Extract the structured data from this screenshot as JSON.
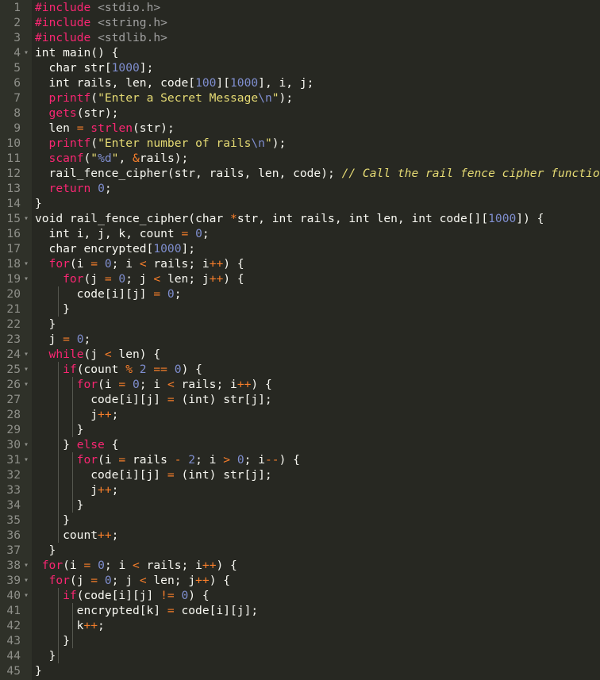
{
  "editor": {
    "lines": [
      {
        "num": "1",
        "fold": "",
        "indent": 0,
        "tokens": [
          {
            "t": "#include ",
            "c": "c-include"
          },
          {
            "t": "<stdio.h>",
            "c": "c-header"
          }
        ]
      },
      {
        "num": "2",
        "fold": "",
        "indent": 0,
        "tokens": [
          {
            "t": "#include ",
            "c": "c-include"
          },
          {
            "t": "<string.h>",
            "c": "c-header"
          }
        ]
      },
      {
        "num": "3",
        "fold": "",
        "indent": 0,
        "tokens": [
          {
            "t": "#include ",
            "c": "c-include"
          },
          {
            "t": "<stdlib.h>",
            "c": "c-header"
          }
        ]
      },
      {
        "num": "4",
        "fold": "▾",
        "indent": 0,
        "tokens": [
          {
            "t": "int main() {",
            "c": ""
          }
        ]
      },
      {
        "num": "5",
        "fold": "",
        "indent": 2,
        "tokens": [
          {
            "t": "char str[",
            "c": ""
          },
          {
            "t": "1000",
            "c": "c-num"
          },
          {
            "t": "];",
            "c": ""
          }
        ]
      },
      {
        "num": "6",
        "fold": "",
        "indent": 2,
        "tokens": [
          {
            "t": "int rails, len, code[",
            "c": ""
          },
          {
            "t": "100",
            "c": "c-num"
          },
          {
            "t": "][",
            "c": ""
          },
          {
            "t": "1000",
            "c": "c-num"
          },
          {
            "t": "], i, j;",
            "c": ""
          }
        ]
      },
      {
        "num": "7",
        "fold": "",
        "indent": 2,
        "tokens": [
          {
            "t": "printf",
            "c": "c-func"
          },
          {
            "t": "(",
            "c": ""
          },
          {
            "t": "\"Enter a Secret Message",
            "c": "c-str"
          },
          {
            "t": "\\n",
            "c": "c-esc"
          },
          {
            "t": "\"",
            "c": "c-str"
          },
          {
            "t": ");",
            "c": ""
          }
        ]
      },
      {
        "num": "8",
        "fold": "",
        "indent": 2,
        "tokens": [
          {
            "t": "gets",
            "c": "c-func"
          },
          {
            "t": "(str);",
            "c": ""
          }
        ]
      },
      {
        "num": "9",
        "fold": "",
        "indent": 2,
        "tokens": [
          {
            "t": "len ",
            "c": ""
          },
          {
            "t": "=",
            "c": "c-op"
          },
          {
            "t": " ",
            "c": ""
          },
          {
            "t": "strlen",
            "c": "c-func"
          },
          {
            "t": "(str);",
            "c": ""
          }
        ]
      },
      {
        "num": "10",
        "fold": "",
        "indent": 2,
        "tokens": [
          {
            "t": "printf",
            "c": "c-func"
          },
          {
            "t": "(",
            "c": ""
          },
          {
            "t": "\"Enter number of rails",
            "c": "c-str"
          },
          {
            "t": "\\n",
            "c": "c-esc"
          },
          {
            "t": "\"",
            "c": "c-str"
          },
          {
            "t": ");",
            "c": ""
          }
        ]
      },
      {
        "num": "11",
        "fold": "",
        "indent": 2,
        "tokens": [
          {
            "t": "scanf",
            "c": "c-func"
          },
          {
            "t": "(",
            "c": ""
          },
          {
            "t": "\"",
            "c": "c-str"
          },
          {
            "t": "%d",
            "c": "c-esc"
          },
          {
            "t": "\"",
            "c": "c-str"
          },
          {
            "t": ", ",
            "c": ""
          },
          {
            "t": "&",
            "c": "c-op"
          },
          {
            "t": "rails);",
            "c": ""
          }
        ]
      },
      {
        "num": "12",
        "fold": "",
        "indent": 2,
        "tokens": [
          {
            "t": "rail_fence_cipher(str, rails, len, code); ",
            "c": ""
          },
          {
            "t": "// Call the rail fence cipher function",
            "c": "c-cmt"
          }
        ]
      },
      {
        "num": "13",
        "fold": "",
        "indent": 2,
        "tokens": [
          {
            "t": "return ",
            "c": "c-kw"
          },
          {
            "t": "0",
            "c": "c-num"
          },
          {
            "t": ";",
            "c": ""
          }
        ]
      },
      {
        "num": "14",
        "fold": "",
        "indent": 0,
        "tokens": [
          {
            "t": "}",
            "c": ""
          }
        ]
      },
      {
        "num": "15",
        "fold": "▾",
        "indent": 0,
        "tokens": [
          {
            "t": "void rail_fence_cipher(char ",
            "c": ""
          },
          {
            "t": "*",
            "c": "c-ptr"
          },
          {
            "t": "str, int rails, int len, int code[][",
            "c": ""
          },
          {
            "t": "1000",
            "c": "c-num"
          },
          {
            "t": "]) {",
            "c": ""
          }
        ]
      },
      {
        "num": "16",
        "fold": "",
        "indent": 2,
        "tokens": [
          {
            "t": "int i, j, k, count ",
            "c": ""
          },
          {
            "t": "=",
            "c": "c-op"
          },
          {
            "t": " ",
            "c": ""
          },
          {
            "t": "0",
            "c": "c-num"
          },
          {
            "t": ";",
            "c": ""
          }
        ]
      },
      {
        "num": "17",
        "fold": "",
        "indent": 2,
        "tokens": [
          {
            "t": "char encrypted[",
            "c": ""
          },
          {
            "t": "1000",
            "c": "c-num"
          },
          {
            "t": "];",
            "c": ""
          }
        ]
      },
      {
        "num": "18",
        "fold": "▾",
        "indent": 2,
        "tokens": [
          {
            "t": "for",
            "c": "c-kw"
          },
          {
            "t": "(i ",
            "c": ""
          },
          {
            "t": "=",
            "c": "c-op"
          },
          {
            "t": " ",
            "c": ""
          },
          {
            "t": "0",
            "c": "c-num"
          },
          {
            "t": "; i ",
            "c": ""
          },
          {
            "t": "<",
            "c": "c-op"
          },
          {
            "t": " rails; i",
            "c": ""
          },
          {
            "t": "++",
            "c": "c-op"
          },
          {
            "t": ") {",
            "c": ""
          }
        ]
      },
      {
        "num": "19",
        "fold": "▾",
        "indent": 4,
        "tokens": [
          {
            "t": "for",
            "c": "c-kw"
          },
          {
            "t": "(j ",
            "c": ""
          },
          {
            "t": "=",
            "c": "c-op"
          },
          {
            "t": " ",
            "c": ""
          },
          {
            "t": "0",
            "c": "c-num"
          },
          {
            "t": "; j ",
            "c": ""
          },
          {
            "t": "<",
            "c": "c-op"
          },
          {
            "t": " len; j",
            "c": ""
          },
          {
            "t": "++",
            "c": "c-op"
          },
          {
            "t": ") {",
            "c": ""
          }
        ]
      },
      {
        "num": "20",
        "fold": "",
        "indent": 6,
        "tokens": [
          {
            "t": "code[i][j] ",
            "c": ""
          },
          {
            "t": "=",
            "c": "c-op"
          },
          {
            "t": " ",
            "c": ""
          },
          {
            "t": "0",
            "c": "c-num"
          },
          {
            "t": ";",
            "c": ""
          }
        ]
      },
      {
        "num": "21",
        "fold": "",
        "indent": 4,
        "tokens": [
          {
            "t": "}",
            "c": ""
          }
        ]
      },
      {
        "num": "22",
        "fold": "",
        "indent": 2,
        "tokens": [
          {
            "t": "}",
            "c": ""
          }
        ]
      },
      {
        "num": "23",
        "fold": "",
        "indent": 2,
        "tokens": [
          {
            "t": "j ",
            "c": ""
          },
          {
            "t": "=",
            "c": "c-op"
          },
          {
            "t": " ",
            "c": ""
          },
          {
            "t": "0",
            "c": "c-num"
          },
          {
            "t": ";",
            "c": ""
          }
        ]
      },
      {
        "num": "24",
        "fold": "▾",
        "indent": 2,
        "tokens": [
          {
            "t": "while",
            "c": "c-kw"
          },
          {
            "t": "(j ",
            "c": ""
          },
          {
            "t": "<",
            "c": "c-op"
          },
          {
            "t": " len) {",
            "c": ""
          }
        ]
      },
      {
        "num": "25",
        "fold": "▾",
        "indent": 4,
        "tokens": [
          {
            "t": "if",
            "c": "c-kw"
          },
          {
            "t": "(count ",
            "c": ""
          },
          {
            "t": "%",
            "c": "c-op"
          },
          {
            "t": " ",
            "c": ""
          },
          {
            "t": "2",
            "c": "c-num"
          },
          {
            "t": " ",
            "c": ""
          },
          {
            "t": "==",
            "c": "c-op"
          },
          {
            "t": " ",
            "c": ""
          },
          {
            "t": "0",
            "c": "c-num"
          },
          {
            "t": ") {",
            "c": ""
          }
        ]
      },
      {
        "num": "26",
        "fold": "▾",
        "indent": 6,
        "tokens": [
          {
            "t": "for",
            "c": "c-kw"
          },
          {
            "t": "(i ",
            "c": ""
          },
          {
            "t": "=",
            "c": "c-op"
          },
          {
            "t": " ",
            "c": ""
          },
          {
            "t": "0",
            "c": "c-num"
          },
          {
            "t": "; i ",
            "c": ""
          },
          {
            "t": "<",
            "c": "c-op"
          },
          {
            "t": " rails; i",
            "c": ""
          },
          {
            "t": "++",
            "c": "c-op"
          },
          {
            "t": ") {",
            "c": ""
          }
        ]
      },
      {
        "num": "27",
        "fold": "",
        "indent": 8,
        "tokens": [
          {
            "t": "code[i][j] ",
            "c": ""
          },
          {
            "t": "=",
            "c": "c-op"
          },
          {
            "t": " (int) str[j];",
            "c": ""
          }
        ]
      },
      {
        "num": "28",
        "fold": "",
        "indent": 8,
        "tokens": [
          {
            "t": "j",
            "c": ""
          },
          {
            "t": "++",
            "c": "c-op"
          },
          {
            "t": ";",
            "c": ""
          }
        ]
      },
      {
        "num": "29",
        "fold": "",
        "indent": 6,
        "tokens": [
          {
            "t": "}",
            "c": ""
          }
        ]
      },
      {
        "num": "30",
        "fold": "▾",
        "indent": 4,
        "tokens": [
          {
            "t": "} ",
            "c": ""
          },
          {
            "t": "else",
            "c": "c-kw"
          },
          {
            "t": " {",
            "c": ""
          }
        ]
      },
      {
        "num": "31",
        "fold": "▾",
        "indent": 6,
        "tokens": [
          {
            "t": "for",
            "c": "c-kw"
          },
          {
            "t": "(i ",
            "c": ""
          },
          {
            "t": "=",
            "c": "c-op"
          },
          {
            "t": " rails ",
            "c": ""
          },
          {
            "t": "-",
            "c": "c-op"
          },
          {
            "t": " ",
            "c": ""
          },
          {
            "t": "2",
            "c": "c-num"
          },
          {
            "t": "; i ",
            "c": ""
          },
          {
            "t": ">",
            "c": "c-op"
          },
          {
            "t": " ",
            "c": ""
          },
          {
            "t": "0",
            "c": "c-num"
          },
          {
            "t": "; i",
            "c": ""
          },
          {
            "t": "--",
            "c": "c-op"
          },
          {
            "t": ") {",
            "c": ""
          }
        ]
      },
      {
        "num": "32",
        "fold": "",
        "indent": 8,
        "tokens": [
          {
            "t": "code[i][j] ",
            "c": ""
          },
          {
            "t": "=",
            "c": "c-op"
          },
          {
            "t": " (int) str[j];",
            "c": ""
          }
        ]
      },
      {
        "num": "33",
        "fold": "",
        "indent": 8,
        "tokens": [
          {
            "t": "j",
            "c": ""
          },
          {
            "t": "++",
            "c": "c-op"
          },
          {
            "t": ";",
            "c": ""
          }
        ]
      },
      {
        "num": "34",
        "fold": "",
        "indent": 6,
        "tokens": [
          {
            "t": "}",
            "c": ""
          }
        ]
      },
      {
        "num": "35",
        "fold": "",
        "indent": 4,
        "tokens": [
          {
            "t": "}",
            "c": ""
          }
        ]
      },
      {
        "num": "36",
        "fold": "",
        "indent": 4,
        "tokens": [
          {
            "t": "count",
            "c": ""
          },
          {
            "t": "++",
            "c": "c-op"
          },
          {
            "t": ";",
            "c": ""
          }
        ]
      },
      {
        "num": "37",
        "fold": "",
        "indent": 2,
        "tokens": [
          {
            "t": "}",
            "c": ""
          }
        ]
      },
      {
        "num": "38",
        "fold": "▾",
        "indent": 1,
        "tokens": [
          {
            "t": "for",
            "c": "c-kw"
          },
          {
            "t": "(i ",
            "c": ""
          },
          {
            "t": "=",
            "c": "c-op"
          },
          {
            "t": " ",
            "c": ""
          },
          {
            "t": "0",
            "c": "c-num"
          },
          {
            "t": "; i ",
            "c": ""
          },
          {
            "t": "<",
            "c": "c-op"
          },
          {
            "t": " rails; i",
            "c": ""
          },
          {
            "t": "++",
            "c": "c-op"
          },
          {
            "t": ") {",
            "c": ""
          }
        ]
      },
      {
        "num": "39",
        "fold": "▾",
        "indent": 2,
        "tokens": [
          {
            "t": "for",
            "c": "c-kw"
          },
          {
            "t": "(j ",
            "c": ""
          },
          {
            "t": "=",
            "c": "c-op"
          },
          {
            "t": " ",
            "c": ""
          },
          {
            "t": "0",
            "c": "c-num"
          },
          {
            "t": "; j ",
            "c": ""
          },
          {
            "t": "<",
            "c": "c-op"
          },
          {
            "t": " len; j",
            "c": ""
          },
          {
            "t": "++",
            "c": "c-op"
          },
          {
            "t": ") {",
            "c": ""
          }
        ]
      },
      {
        "num": "40",
        "fold": "▾",
        "indent": 4,
        "tokens": [
          {
            "t": "if",
            "c": "c-kw"
          },
          {
            "t": "(code[i][j] ",
            "c": ""
          },
          {
            "t": "!=",
            "c": "c-op"
          },
          {
            "t": " ",
            "c": ""
          },
          {
            "t": "0",
            "c": "c-num"
          },
          {
            "t": ") {",
            "c": ""
          }
        ]
      },
      {
        "num": "41",
        "fold": "",
        "indent": 6,
        "tokens": [
          {
            "t": "encrypted[k] ",
            "c": ""
          },
          {
            "t": "=",
            "c": "c-op"
          },
          {
            "t": " code[i][j];",
            "c": ""
          }
        ]
      },
      {
        "num": "42",
        "fold": "",
        "indent": 6,
        "tokens": [
          {
            "t": "k",
            "c": ""
          },
          {
            "t": "++",
            "c": "c-op"
          },
          {
            "t": ";",
            "c": ""
          }
        ]
      },
      {
        "num": "43",
        "fold": "",
        "indent": 4,
        "tokens": [
          {
            "t": "}",
            "c": ""
          }
        ]
      },
      {
        "num": "44",
        "fold": "",
        "indent": 2,
        "tokens": [
          {
            "t": "}",
            "c": ""
          }
        ]
      },
      {
        "num": "45",
        "fold": "",
        "indent": 0,
        "tokens": [
          {
            "t": "}",
            "c": ""
          }
        ]
      }
    ]
  }
}
